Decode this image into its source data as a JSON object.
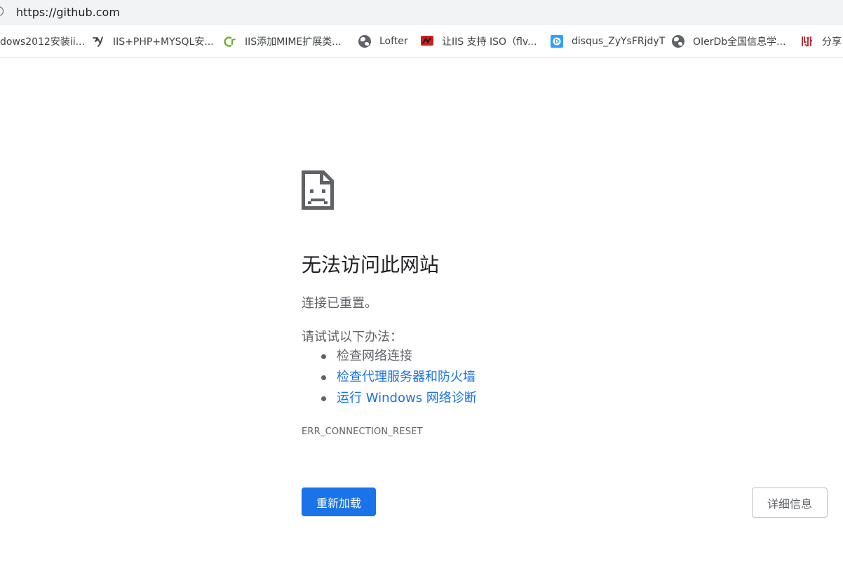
{
  "omnibox": {
    "url": "https://github.com"
  },
  "bookmarks": [
    {
      "label": "dows2012安装ii...",
      "icon": "none"
    },
    {
      "label": "IIS+PHP+MYSQL安...",
      "icon": "bird-logo-icon"
    },
    {
      "label": "IIS添加MIME扩展类...",
      "icon": "green-leaf-icon"
    },
    {
      "label": "Lofter",
      "icon": "globe-icon"
    },
    {
      "label": "让IIS 支持 ISO（flv...",
      "icon": "red-logo-icon"
    },
    {
      "label": "disqus_ZyYsFRjdyT",
      "icon": "disqus-icon"
    },
    {
      "label": "OIerDb全国信息学...",
      "icon": "globe-icon"
    },
    {
      "label": "分享",
      "icon": "red-pattern-icon"
    }
  ],
  "error": {
    "title": "无法访问此网站",
    "description": "连接已重置。",
    "suggestions_heading": "请试试以下办法：",
    "suggestions": [
      "检查网络连接",
      "检查代理服务器和防火墙",
      "运行 Windows 网络诊断"
    ],
    "code": "ERR_CONNECTION_RESET"
  },
  "buttons": {
    "reload": "重新加载",
    "details": "详细信息"
  },
  "colors": {
    "link": "#1a73e8",
    "primary_button": "#1a73e8",
    "text_secondary": "#5f6368"
  }
}
